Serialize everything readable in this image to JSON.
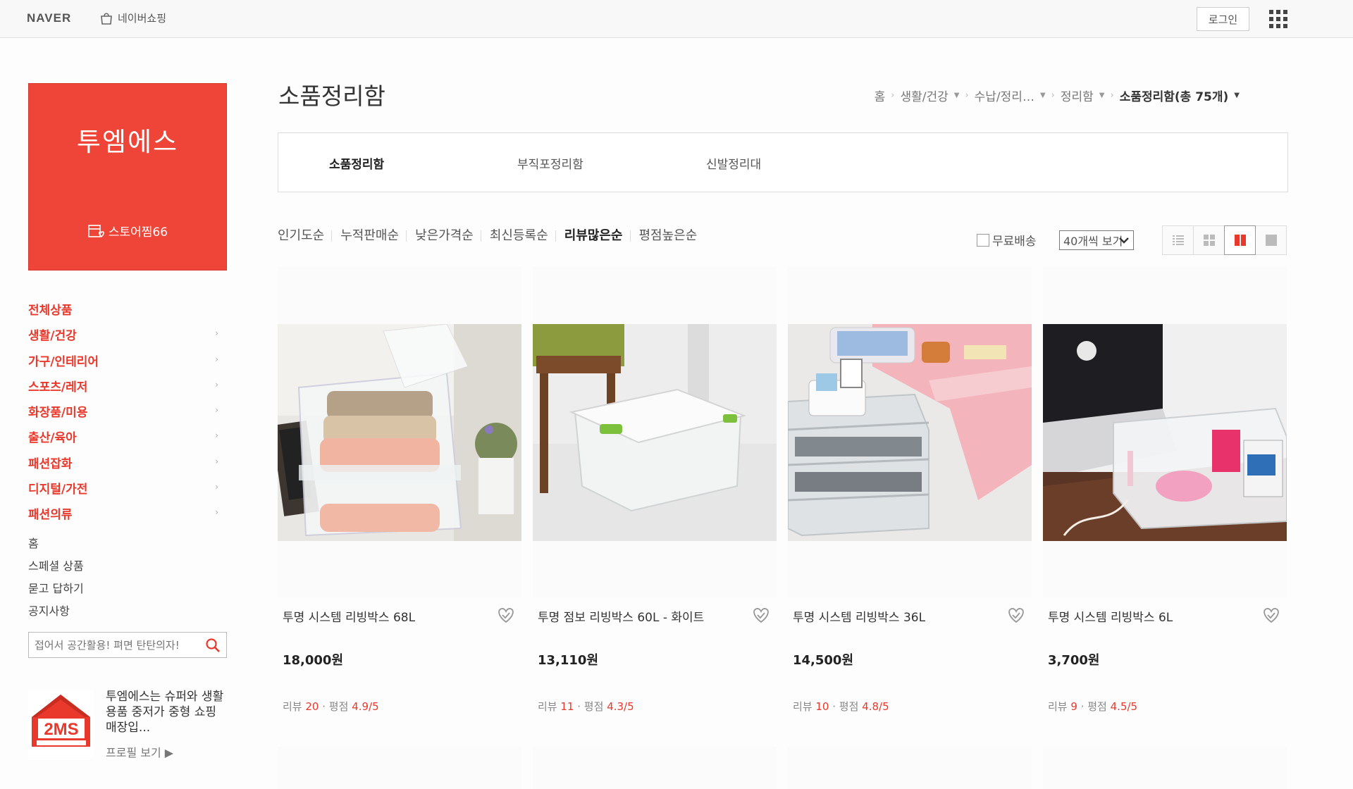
{
  "topbar": {
    "logo": "NAVER",
    "shop_link": "네이버쇼핑",
    "login": "로그인"
  },
  "store": {
    "name": "투엠에스",
    "favorites": "스토어찜66",
    "brand_color": "#ef4538"
  },
  "categories": [
    {
      "label": "전체상품",
      "has_children": false
    },
    {
      "label": "생활/건강",
      "has_children": true
    },
    {
      "label": "가구/인테리어",
      "has_children": true
    },
    {
      "label": "스포츠/레저",
      "has_children": true
    },
    {
      "label": "화장품/미용",
      "has_children": true
    },
    {
      "label": "출산/육아",
      "has_children": true
    },
    {
      "label": "패션잡화",
      "has_children": true
    },
    {
      "label": "디지털/가전",
      "has_children": true
    },
    {
      "label": "패션의류",
      "has_children": true
    }
  ],
  "sub_links": [
    "홈",
    "스페셜 상품",
    "묻고 답하기",
    "공지사항"
  ],
  "side_search": {
    "placeholder": "접어서 공간활용! 펴면 탄탄의자!"
  },
  "profile": {
    "description": "투엠에스는 슈퍼와 생활용품 중저가 중형 쇼핑 매장입...",
    "button": "프로필 보기 ▶"
  },
  "page": {
    "title": "소품정리함",
    "breadcrumb": [
      "홈",
      "생활/건강",
      "수납/정리…",
      "정리함"
    ],
    "breadcrumb_current": "소품정리함(총 75개)"
  },
  "subcategories": [
    {
      "label": "소품정리함",
      "active": true
    },
    {
      "label": "부직포정리함",
      "active": false
    },
    {
      "label": "신발정리대",
      "active": false
    }
  ],
  "sort_options": [
    {
      "label": "인기도순",
      "active": false
    },
    {
      "label": "누적판매순",
      "active": false
    },
    {
      "label": "낮은가격순",
      "active": false
    },
    {
      "label": "최신등록순",
      "active": false
    },
    {
      "label": "리뷰많은순",
      "active": true
    },
    {
      "label": "평점높은순",
      "active": false
    }
  ],
  "filters": {
    "free_shipping": "무료배송",
    "per_page": "40개씩 보기"
  },
  "products": [
    {
      "name": "투명 시스템 리빙박스 68L",
      "price": "18,000원",
      "review_label": "리뷰",
      "reviews": "20",
      "rating_label": "평점",
      "rating": "4.9",
      "rating_max": "/5"
    },
    {
      "name": "투명 점보 리빙박스 60L - 화이트",
      "price": "13,110원",
      "review_label": "리뷰",
      "reviews": "11",
      "rating_label": "평점",
      "rating": "4.3",
      "rating_max": "/5"
    },
    {
      "name": "투명 시스템 리빙박스 36L",
      "price": "14,500원",
      "review_label": "리뷰",
      "reviews": "10",
      "rating_label": "평점",
      "rating": "4.8",
      "rating_max": "/5"
    },
    {
      "name": "투명 시스템 리빙박스 6L",
      "price": "3,700원",
      "review_label": "리뷰",
      "reviews": "9",
      "rating_label": "평점",
      "rating": "4.5",
      "rating_max": "/5"
    }
  ]
}
